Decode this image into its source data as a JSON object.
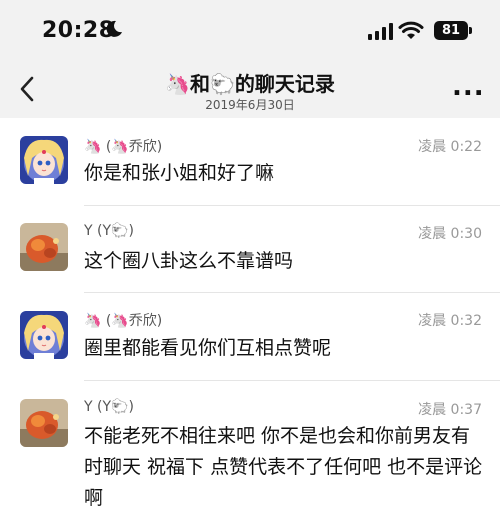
{
  "status_bar": {
    "time": "20:28",
    "battery": "81"
  },
  "header": {
    "title": "🦄和🐑的聊天记录",
    "subtitle": "2019年6月30日",
    "back_label": "<",
    "more_label": "..."
  },
  "messages": [
    {
      "sender": "🦄 (🦄乔欣)",
      "time": "凌晨 0:22",
      "text": "你是和张小姐和好了嘛",
      "avatar": "sailor-moon-avatar"
    },
    {
      "sender": "Y (Y🐑)",
      "time": "凌晨 0:30",
      "text": "这个圈八卦这么不靠谱吗",
      "avatar": "cat-avatar"
    },
    {
      "sender": "🦄 (🦄乔欣)",
      "time": "凌晨 0:32",
      "text": "圈里都能看见你们互相点赞呢",
      "avatar": "sailor-moon-avatar"
    },
    {
      "sender": "Y (Y🐑)",
      "time": "凌晨 0:37",
      "text": "不能老死不相往来吧 你不是也会和你前男友有时聊天 祝福下 点赞代表不了任何吧 也不是评论啊",
      "avatar": "cat-avatar"
    }
  ],
  "colors": {
    "header_bg": "#f2f2f2",
    "meta_text": "#999999",
    "name_text": "#555555"
  }
}
